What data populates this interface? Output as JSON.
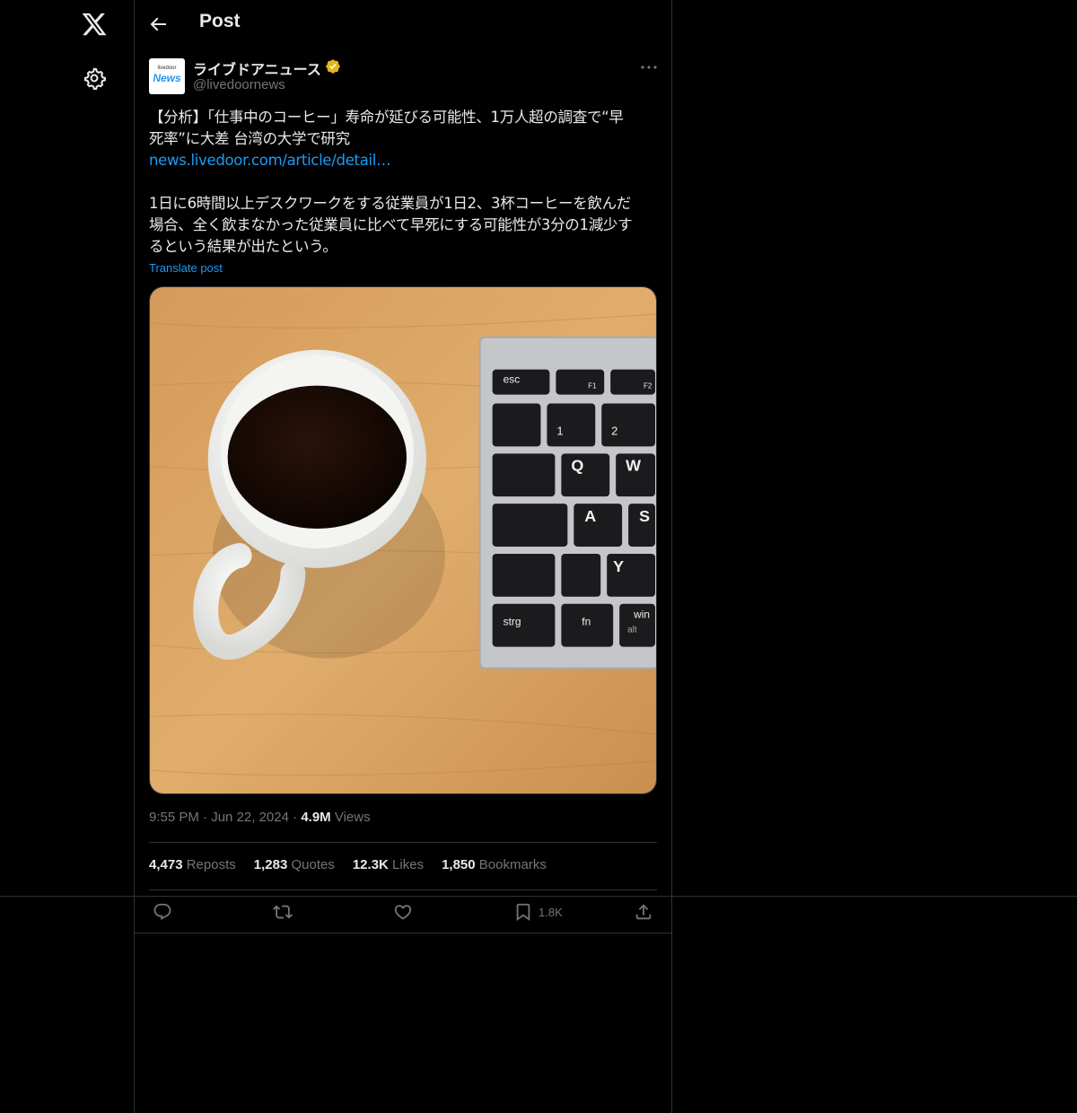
{
  "nav": {
    "logo_icon": "x-logo-icon",
    "settings_icon": "gear-icon"
  },
  "header": {
    "back_icon": "arrow-left-icon",
    "title": "Post"
  },
  "post": {
    "avatar_small": "livedoor",
    "avatar_big": "News",
    "display_name": "ライブドアニュース",
    "verified_icon": "verified-gold-badge-icon",
    "handle": "@livedoornews",
    "text_lines": [
      "【分析】「仕事中のコーヒー」寿命が延びる可能性、1万人超の調査で“早",
      "死率”に大差 台湾の大学で研究"
    ],
    "link": "news.livedoor.com/article/detail…",
    "text2_lines": [
      "1日に6時間以上デスクワークをする従業員が1日2、3杯コーヒーを飲んだ",
      "場合、全く飲まなかった従業員に比べて早死にする可能性が3分の1減少す",
      "るという結果が出たという。"
    ],
    "translate": "Translate post",
    "time": "9:55 PM",
    "date": "Jun 22, 2024",
    "views_count": "4.9M",
    "views_label": "Views",
    "sep": "·"
  },
  "stats": [
    {
      "count": "4,473",
      "label": "Reposts"
    },
    {
      "count": "1,283",
      "label": "Quotes"
    },
    {
      "count": "12.3K",
      "label": "Likes"
    },
    {
      "count": "1,850",
      "label": "Bookmarks"
    }
  ],
  "actions": {
    "bookmark_count": "1.8K"
  },
  "keyboard": {
    "keys": [
      "esc",
      "F1",
      "F2",
      "1",
      "2",
      "Q",
      "W",
      "A",
      "S",
      "Y",
      "strg",
      "fn",
      "win",
      "alt"
    ]
  }
}
